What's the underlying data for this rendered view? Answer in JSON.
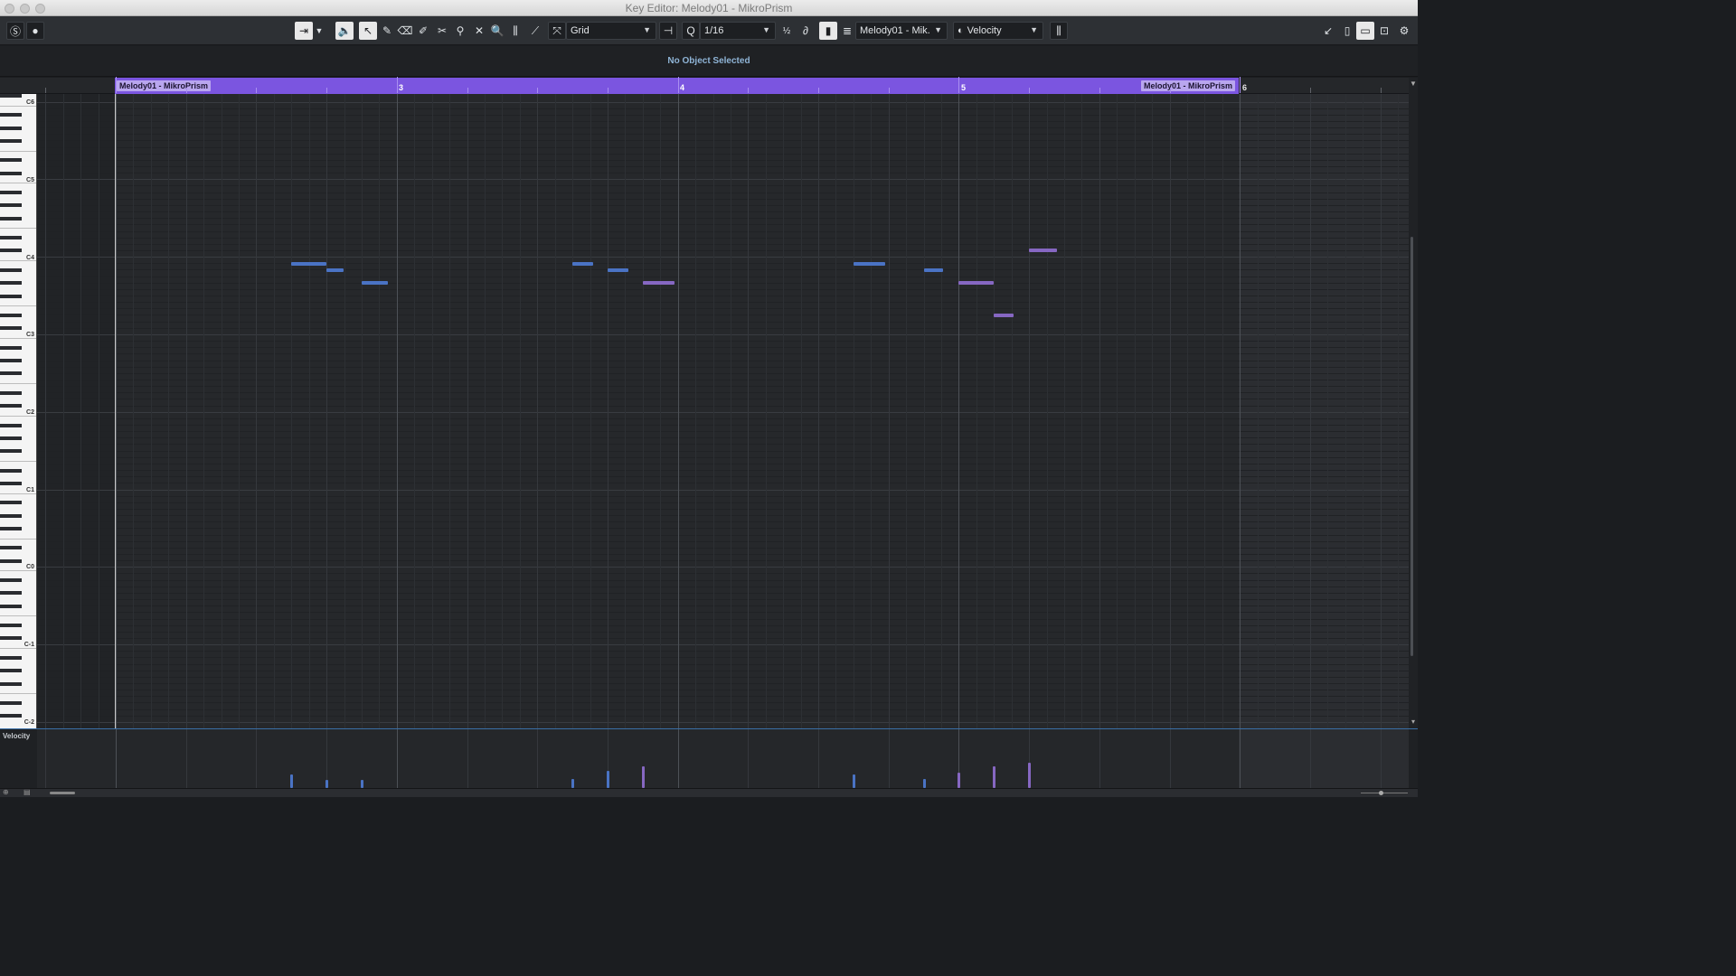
{
  "window": {
    "title": "Key Editor: Melody01 - MikroPrism"
  },
  "toolbar": {
    "snap_type": "Grid",
    "quantize": "1/16",
    "part_select": "Melody01 - Mik.",
    "lane_select": "Velocity",
    "tools": [
      "solo-icon",
      "record-icon",
      "auto-scroll-icon",
      "dropdown-icon",
      "acoustic-feedback-icon",
      "object-selection-icon",
      "draw-icon",
      "erase-icon",
      "trim-icon",
      "split-icon",
      "glue-icon",
      "zoom-icon",
      "mute-icon",
      "line-icon",
      "snap-icon",
      "insert-velocity-icon",
      "quantize-icon",
      "iterative-quantize-icon",
      "quantize-preset-icon",
      "independent-track-loop-icon",
      "edit-active-part-icon",
      "chords-icon",
      "virtual-keyboard-icon",
      "left-zone-icon",
      "right-zone-icon",
      "lower-zone-icon",
      "info-line-icon",
      "settings-icon"
    ]
  },
  "info_line": {
    "message": "No Object Selected"
  },
  "ruler": {
    "event_label_start": "Melody01 - MikroPrism",
    "event_label_end": "Melody01 - MikroPrism",
    "bars": [
      "3",
      "4",
      "5",
      "6"
    ]
  },
  "keyboard": {
    "octave_labels": [
      "C6",
      "C5",
      "C4",
      "C3",
      "C2",
      "C1",
      "C0",
      "C-1",
      "C-2"
    ]
  },
  "notes": [
    {
      "pitch": "B3",
      "start": 2.5,
      "length": 0.5,
      "velocity": 0.25
    },
    {
      "pitch": "A#3",
      "start": 3.0,
      "length": 0.25,
      "velocity": 0.14
    },
    {
      "pitch": "G#3",
      "start": 3.5,
      "length": 0.375,
      "velocity": 0.14
    },
    {
      "pitch": "B3",
      "start": 6.5,
      "length": 0.3,
      "velocity": 0.16
    },
    {
      "pitch": "A#3",
      "start": 7.0,
      "length": 0.3,
      "velocity": 0.31
    },
    {
      "pitch": "G#3",
      "start": 7.5,
      "length": 0.45,
      "velocity": 0.39
    },
    {
      "pitch": "B3",
      "start": 10.5,
      "length": 0.45,
      "velocity": 0.25
    },
    {
      "pitch": "A#3",
      "start": 11.5,
      "length": 0.28,
      "velocity": 0.16
    },
    {
      "pitch": "G#3",
      "start": 12.0,
      "length": 0.5,
      "velocity": 0.27
    },
    {
      "pitch": "D#3",
      "start": 12.5,
      "length": 0.28,
      "velocity": 0.38
    },
    {
      "pitch": "C#4",
      "start": 13.0,
      "length": 0.4,
      "velocity": 0.45
    }
  ],
  "velocity_lane": {
    "label": "Velocity"
  },
  "colors": {
    "event": "#7b55e0",
    "note_blue": "#4a73c4",
    "note_purple": "#8667c2",
    "accent": "#3a6fa7"
  }
}
